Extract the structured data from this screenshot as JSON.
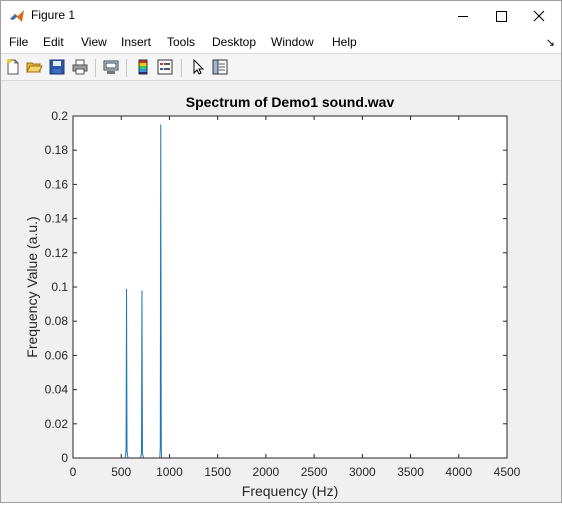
{
  "window": {
    "title": "Figure 1",
    "controls": {
      "minimize": "—",
      "maximize": "☐",
      "close": "✕"
    }
  },
  "menu": {
    "items": [
      "File",
      "Edit",
      "View",
      "Insert",
      "Tools",
      "Desktop",
      "Window",
      "Help"
    ],
    "overflow": "↘"
  },
  "toolbar": {
    "buttons": [
      {
        "name": "new-figure-button",
        "icon": "new-file-icon"
      },
      {
        "name": "open-file-button",
        "icon": "folder-open-icon"
      },
      {
        "name": "save-button",
        "icon": "save-disk-icon"
      },
      {
        "name": "print-button",
        "icon": "printer-icon"
      },
      {
        "name": "link-plot-button",
        "icon": "link-plot-icon"
      },
      {
        "name": "insert-colorbar-button",
        "icon": "colorbar-icon"
      },
      {
        "name": "insert-legend-button",
        "icon": "legend-icon"
      },
      {
        "name": "edit-plot-button",
        "icon": "cursor-arrow-icon"
      },
      {
        "name": "property-inspector-button",
        "icon": "property-panel-icon"
      }
    ]
  },
  "colors": {
    "line": "#1f77b4",
    "axes_bg": "#ffffff",
    "figure_bg": "#f0f0f0"
  },
  "chart_data": {
    "type": "line",
    "title": "Spectrum of Demo1 sound.wav",
    "xlabel": "Frequency (Hz)",
    "ylabel": "Frequency Value (a.u.)",
    "xlim": [
      0,
      4500
    ],
    "ylim": [
      0,
      0.2
    ],
    "xticks": [
      0,
      500,
      1000,
      1500,
      2000,
      2500,
      3000,
      3500,
      4000,
      4500
    ],
    "yticks": [
      0,
      0.02,
      0.04,
      0.06,
      0.08,
      0.1,
      0.12,
      0.14,
      0.16,
      0.18,
      0.2
    ],
    "xtick_labels": [
      "0",
      "500",
      "1000",
      "1500",
      "2000",
      "2500",
      "3000",
      "3500",
      "4000",
      "4500"
    ],
    "ytick_labels": [
      "0",
      "0.02",
      "0.04",
      "0.06",
      "0.08",
      "0.1",
      "0.12",
      "0.14",
      "0.16",
      "0.18",
      "0.2"
    ],
    "grid": false,
    "series": [
      {
        "x": [
          0,
          540,
          550,
          555,
          560,
          570,
          700,
          710,
          715,
          720,
          730,
          900,
          905,
          910,
          915,
          920,
          4096
        ],
        "y": [
          0,
          0,
          0.004,
          0.099,
          0.004,
          0,
          0,
          0.003,
          0.098,
          0.003,
          0,
          0,
          0.006,
          0.195,
          0.006,
          0,
          0
        ]
      }
    ]
  }
}
